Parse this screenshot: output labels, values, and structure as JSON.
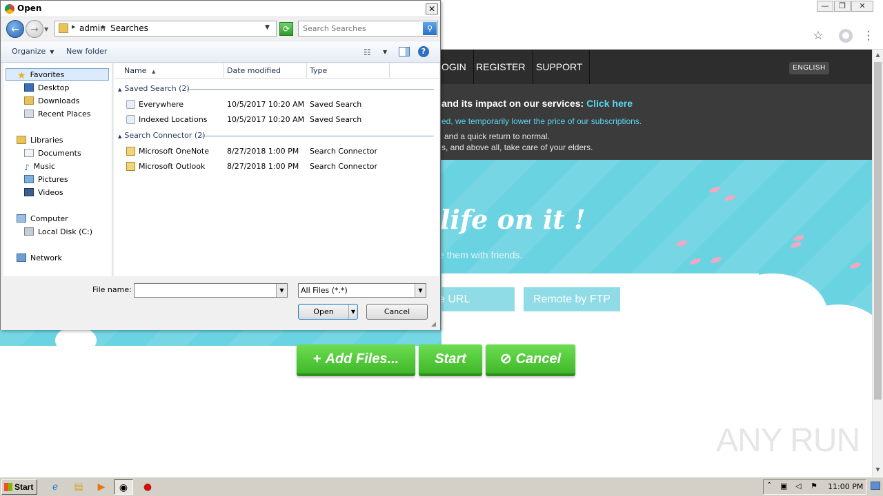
{
  "browser": {
    "window_controls": {
      "minimize": "—",
      "restore": "❐",
      "close": "✕"
    },
    "toolbar_icons": [
      "star-icon",
      "avatar-icon",
      "kebab-menu-icon"
    ]
  },
  "site": {
    "nav": [
      "OGIN",
      "REGISTER",
      "SUPPORT"
    ],
    "language": "ENGLISH",
    "notice": {
      "line1_bold": "and its impact on our services: ",
      "line1_link": "Click here",
      "line2": "ed, we temporarily lower the price of our subscriptions.",
      "line3": "and a quick return to normal.",
      "line4": "s, and above all, take care of your elders."
    },
    "hero_title": "life on it !",
    "hero_sub": "e them with friends.",
    "hero_buttons": [
      "e URL upload",
      "Remote by FTP"
    ],
    "actions": {
      "add": "Add Files...",
      "start": "Start",
      "cancel": "Cancel"
    },
    "watermark": "ANY  RUN",
    "colors": {
      "nav_bg": "#2d2d2d",
      "notice_bg": "#3b3b3b",
      "hero_bg": "#6ad3e2",
      "action_green": "#4cc236",
      "link": "#5bd6f0"
    }
  },
  "dialog": {
    "title": "Open",
    "close": "✕",
    "breadcrumb": [
      "admin",
      "Searches"
    ],
    "search_placeholder": "Search Searches",
    "commands": {
      "organize": "Organize",
      "new_folder": "New folder"
    },
    "nav_pane": {
      "favorites": "Favorites",
      "favorites_items": [
        "Desktop",
        "Downloads",
        "Recent Places"
      ],
      "libraries": "Libraries",
      "libraries_items": [
        "Documents",
        "Music",
        "Pictures",
        "Videos"
      ],
      "computer": "Computer",
      "computer_items": [
        "Local Disk (C:)"
      ],
      "network": "Network"
    },
    "columns": {
      "name": "Name",
      "date": "Date modified",
      "type": "Type"
    },
    "groups": [
      {
        "label": "Saved Search (2)",
        "rows": [
          {
            "name": "Everywhere",
            "date": "10/5/2017 10:20 AM",
            "type": "Saved Search"
          },
          {
            "name": "Indexed Locations",
            "date": "10/5/2017 10:20 AM",
            "type": "Saved Search"
          }
        ]
      },
      {
        "label": "Search Connector (2)",
        "rows": [
          {
            "name": "Microsoft OneNote",
            "date": "8/27/2018 1:00 PM",
            "type": "Search Connector"
          },
          {
            "name": "Microsoft Outlook",
            "date": "8/27/2018 1:00 PM",
            "type": "Search Connector"
          }
        ]
      }
    ],
    "file_name_label": "File name:",
    "file_name_value": "",
    "filter": "All Files (*.*)",
    "open": "Open",
    "cancel": "Cancel"
  },
  "taskbar": {
    "start": "Start",
    "apps": [
      "ie-icon",
      "explorer-icon",
      "media-player-icon",
      "chrome-icon",
      "stop-icon"
    ],
    "clock": "11:00 PM"
  }
}
